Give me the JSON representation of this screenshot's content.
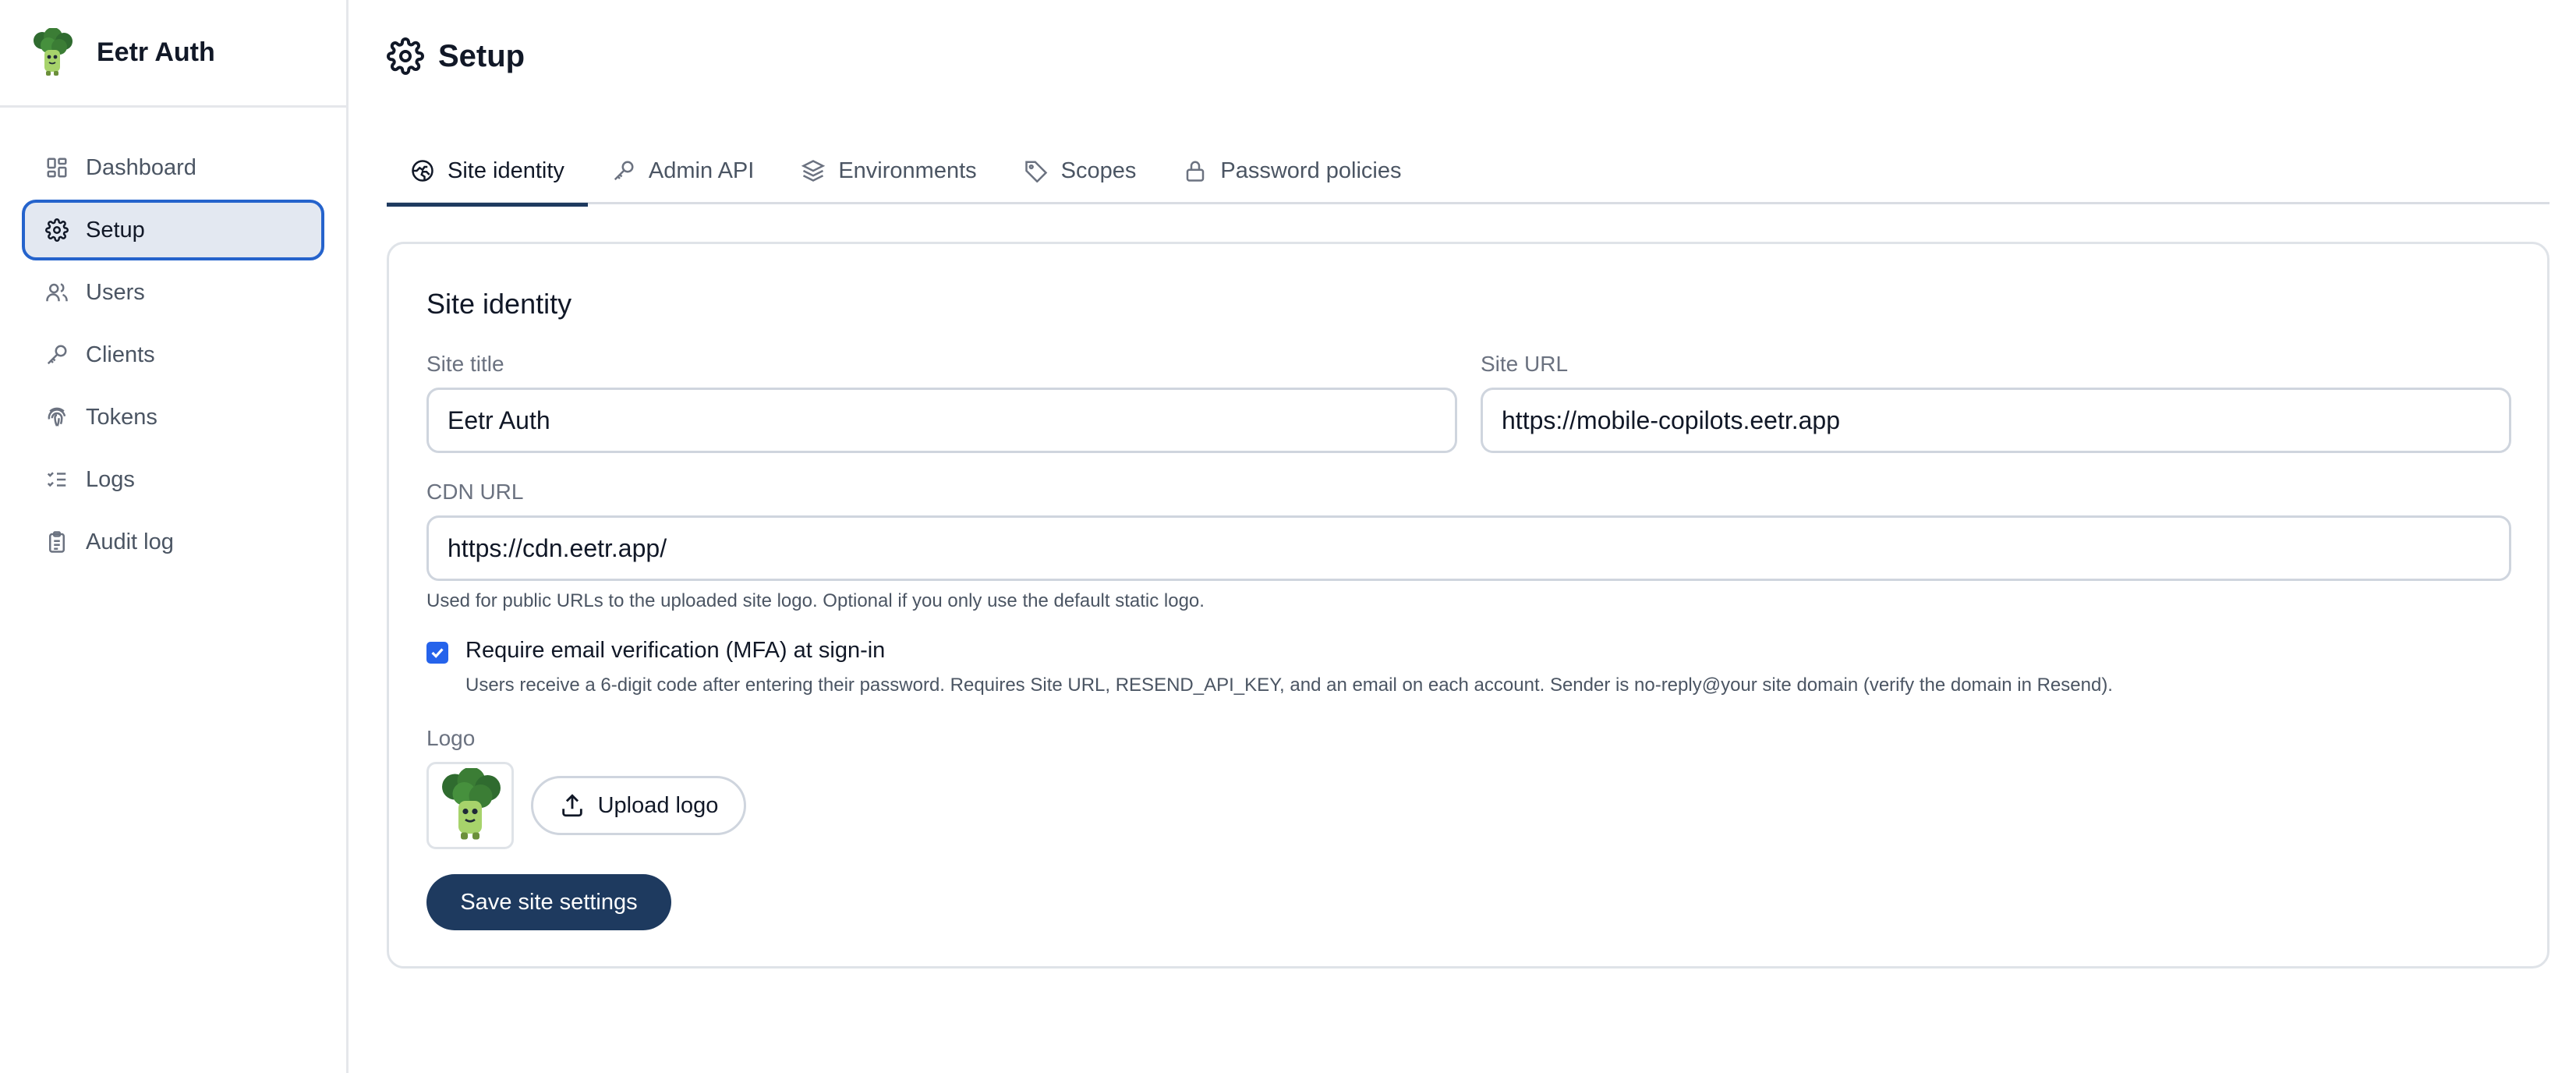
{
  "app": {
    "name": "Eetr Auth"
  },
  "sidebar": {
    "items": [
      {
        "label": "Dashboard",
        "icon": "dashboard-icon",
        "active": false
      },
      {
        "label": "Setup",
        "icon": "gear-icon",
        "active": true
      },
      {
        "label": "Users",
        "icon": "users-icon",
        "active": false
      },
      {
        "label": "Clients",
        "icon": "key-icon",
        "active": false
      },
      {
        "label": "Tokens",
        "icon": "fingerprint-icon",
        "active": false
      },
      {
        "label": "Logs",
        "icon": "list-checks-icon",
        "active": false
      },
      {
        "label": "Audit log",
        "icon": "clipboard-icon",
        "active": false
      }
    ]
  },
  "page": {
    "title": "Setup",
    "icon": "gear-icon"
  },
  "tabs": [
    {
      "label": "Site identity",
      "icon": "globe-icon",
      "active": true
    },
    {
      "label": "Admin API",
      "icon": "key-icon",
      "active": false
    },
    {
      "label": "Environments",
      "icon": "layers-icon",
      "active": false
    },
    {
      "label": "Scopes",
      "icon": "tag-icon",
      "active": false
    },
    {
      "label": "Password policies",
      "icon": "lock-icon",
      "active": false
    }
  ],
  "form": {
    "section_title": "Site identity",
    "site_title": {
      "label": "Site title",
      "value": "Eetr Auth"
    },
    "site_url": {
      "label": "Site URL",
      "value": "https://mobile-copilots.eetr.app"
    },
    "cdn_url": {
      "label": "CDN URL",
      "value": "https://cdn.eetr.app/",
      "help": "Used for public URLs to the uploaded site logo. Optional if you only use the default static logo."
    },
    "mfa": {
      "checked": true,
      "label": "Require email verification (MFA) at sign-in",
      "help": "Users receive a 6-digit code after entering their password. Requires Site URL, RESEND_API_KEY, and an email on each account. Sender is no-reply@your site domain (verify the domain in Resend)."
    },
    "logo": {
      "label": "Logo",
      "upload_label": "Upload logo"
    },
    "save_label": "Save site settings"
  },
  "colors": {
    "accent": "#1e3a5f",
    "active_outline": "#2563cc",
    "active_bg": "#e3e8f1",
    "checkbox": "#2563eb"
  }
}
